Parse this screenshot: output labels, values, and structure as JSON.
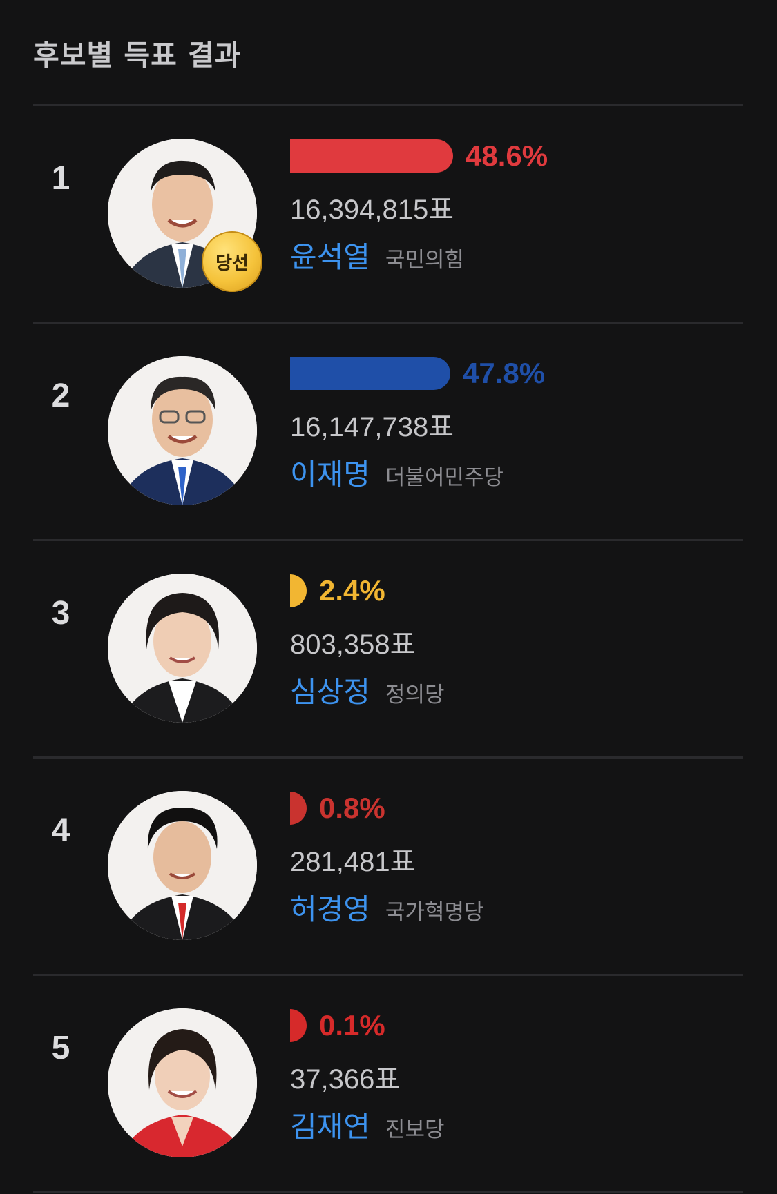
{
  "header": {
    "title": "후보별 득표 결과"
  },
  "colors": {
    "background": "#131314",
    "divider": "#2a2a2d",
    "name_link": "#3d93ef",
    "winner_badge": "#f5c33b"
  },
  "candidates": [
    {
      "rank": "1",
      "percent_label": "48.6%",
      "percent": 48.6,
      "votes": "16,394,815표",
      "name": "윤석열",
      "party": "국민의힘",
      "party_color": "#e03a3e",
      "winner_badge": "당선",
      "avatar_icon": "candidate-portrait-icon"
    },
    {
      "rank": "2",
      "percent_label": "47.8%",
      "percent": 47.8,
      "votes": "16,147,738표",
      "name": "이재명",
      "party": "더불어민주당",
      "party_color": "#1f4fa8",
      "winner_badge": "",
      "avatar_icon": "candidate-portrait-icon"
    },
    {
      "rank": "3",
      "percent_label": "2.4%",
      "percent": 2.4,
      "votes": "803,358표",
      "name": "심상정",
      "party": "정의당",
      "party_color": "#f2b632",
      "winner_badge": "",
      "avatar_icon": "candidate-portrait-icon"
    },
    {
      "rank": "4",
      "percent_label": "0.8%",
      "percent": 0.8,
      "votes": "281,481표",
      "name": "허경영",
      "party": "국가혁명당",
      "party_color": "#c9332f",
      "winner_badge": "",
      "avatar_icon": "candidate-portrait-icon"
    },
    {
      "rank": "5",
      "percent_label": "0.1%",
      "percent": 0.1,
      "votes": "37,366표",
      "name": "김재연",
      "party": "진보당",
      "party_color": "#d62a2a",
      "winner_badge": "",
      "avatar_icon": "candidate-portrait-icon"
    }
  ]
}
